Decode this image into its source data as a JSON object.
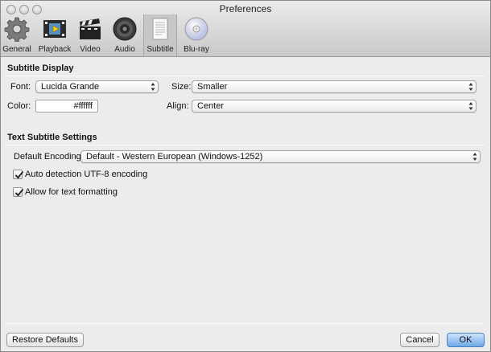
{
  "window": {
    "title": "Preferences"
  },
  "toolbar": {
    "items": [
      {
        "label": "General",
        "icon": "gear-icon"
      },
      {
        "label": "Playback",
        "icon": "filmstrip-play-icon"
      },
      {
        "label": "Video",
        "icon": "clapperboard-icon"
      },
      {
        "label": "Audio",
        "icon": "speaker-icon"
      },
      {
        "label": "Subtitle",
        "icon": "document-icon",
        "selected": true
      },
      {
        "label": "Blu-ray",
        "icon": "disc-icon"
      }
    ]
  },
  "subtitle_display": {
    "heading": "Subtitle Display",
    "font_label": "Font:",
    "font_value": "Lucida Grande",
    "size_label": "Size:",
    "size_value": "Smaller",
    "color_label": "Color:",
    "color_value": "#ffffff",
    "align_label": "Align:",
    "align_value": "Center"
  },
  "text_subtitle_settings": {
    "heading": "Text Subtitle Settings",
    "encoding_label": "Default Encoding:",
    "encoding_value": "Default - Western European (Windows-1252)",
    "auto_detect_label": "Auto detection UTF-8 encoding",
    "auto_detect_checked": true,
    "allow_formatting_label": "Allow for text formatting",
    "allow_formatting_checked": true
  },
  "footer": {
    "restore_label": "Restore Defaults",
    "cancel_label": "Cancel",
    "ok_label": "OK"
  },
  "colors": {
    "accent": "#6ea9e8",
    "selected_tab": "#c7c7c7"
  }
}
